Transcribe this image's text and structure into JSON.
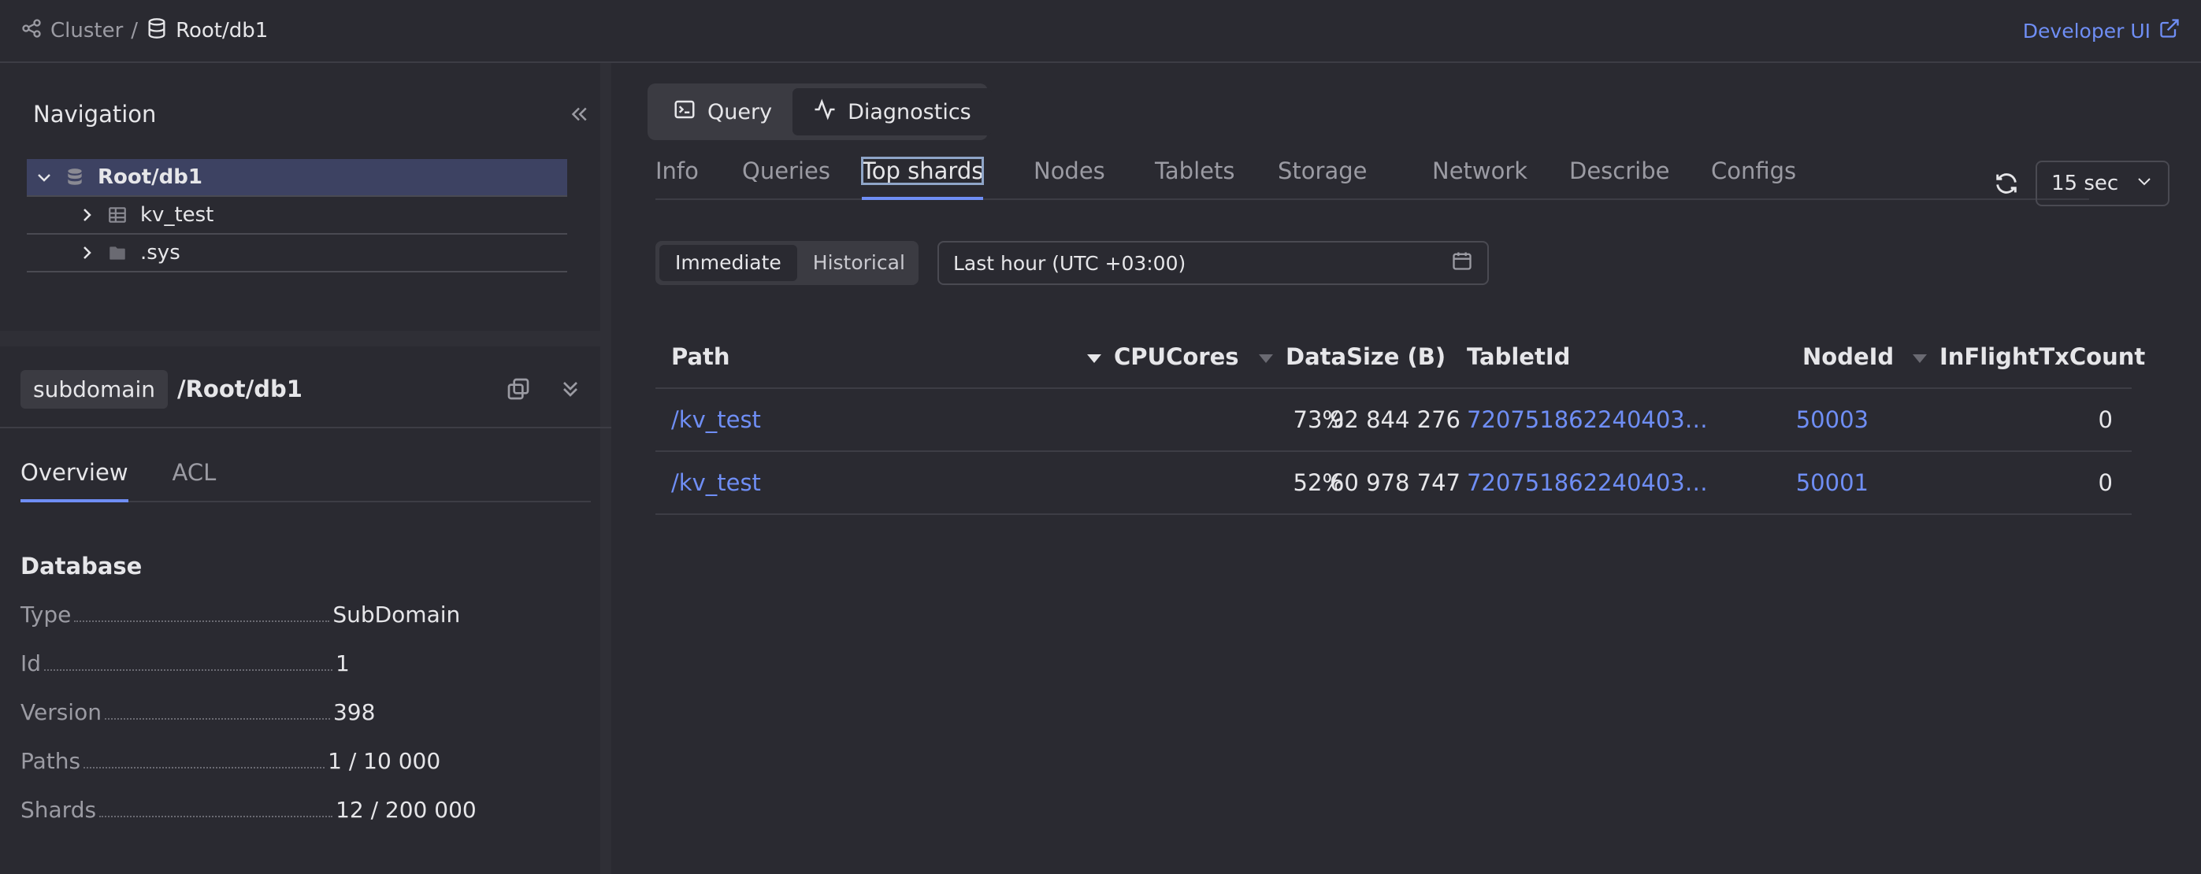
{
  "breadcrumb": {
    "cluster": "Cluster",
    "separator": "/",
    "current": "Root/db1"
  },
  "developer_ui": "Developer UI",
  "navigation": {
    "title": "Navigation",
    "items": [
      {
        "label": "Root/db1"
      },
      {
        "label": "kv_test"
      },
      {
        "label": ".sys"
      }
    ]
  },
  "summary": {
    "badge": "subdomain",
    "path": "/Root/db1",
    "tabs": [
      "Overview",
      "ACL"
    ],
    "section_title": "Database",
    "properties": [
      {
        "key": "Type",
        "value": "SubDomain"
      },
      {
        "key": "Id",
        "value": "1"
      },
      {
        "key": "Version",
        "value": "398"
      },
      {
        "key": "Paths",
        "value": "1 / 10 000"
      },
      {
        "key": "Shards",
        "value": "12 / 200 000"
      }
    ]
  },
  "mode": {
    "query": "Query",
    "diagnostics": "Diagnostics"
  },
  "diagnostics_tabs": [
    "Info",
    "Queries",
    "Top shards",
    "Nodes",
    "Tablets",
    "Storage",
    "Network",
    "Describe",
    "Configs"
  ],
  "refresh_interval": "15 sec",
  "time_mode": {
    "immediate": "Immediate",
    "historical": "Historical"
  },
  "time_range": "Last hour (UTC +03:00)",
  "table": {
    "columns": [
      "Path",
      "CPUCores",
      "DataSize (B)",
      "TabletId",
      "NodeId",
      "InFlightTxCount"
    ],
    "rows": [
      {
        "path": "/kv_test",
        "cpu": "73%",
        "size": "92 844 276",
        "tablet": "720751862240403…",
        "node": "50003",
        "inflight": "0"
      },
      {
        "path": "/kv_test",
        "cpu": "52%",
        "size": "60 978 747",
        "tablet": "720751862240403…",
        "node": "50001",
        "inflight": "0"
      }
    ]
  },
  "colors": {
    "background": "#2a2a31",
    "accent": "#6f8ef5",
    "selected_row": "#3d4262"
  }
}
